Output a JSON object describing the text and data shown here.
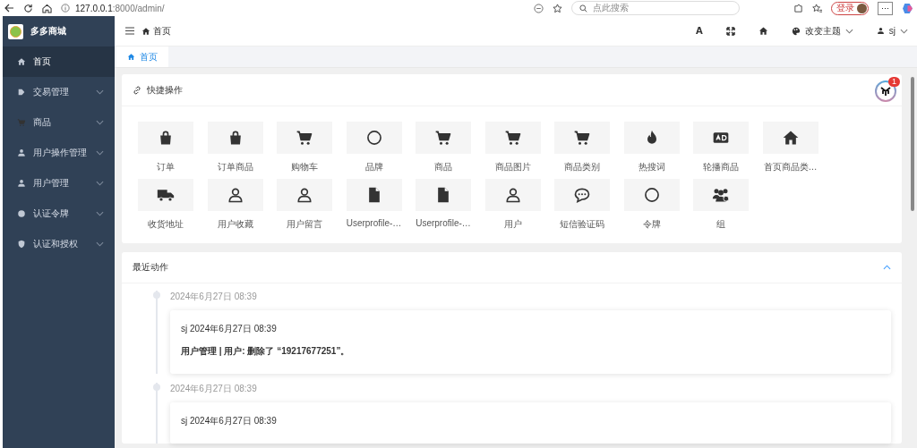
{
  "browser": {
    "url_host": "127.0.0.1",
    "url_path": ":8000/admin/",
    "search_placeholder": "点此搜索",
    "login_label": "登录",
    "more_label": "···"
  },
  "sidebar": {
    "brand": "多多商城",
    "items": [
      {
        "label": "首页",
        "kind": "home",
        "selected": true,
        "expandable": false
      },
      {
        "label": "交易管理",
        "kind": "tag",
        "selected": false,
        "expandable": true
      },
      {
        "label": "商品",
        "kind": "cart",
        "selected": false,
        "expandable": true
      },
      {
        "label": "用户操作管理",
        "kind": "person",
        "selected": false,
        "expandable": true
      },
      {
        "label": "用户管理",
        "kind": "person",
        "selected": false,
        "expandable": true
      },
      {
        "label": "认证令牌",
        "kind": "dot",
        "selected": false,
        "expandable": true
      },
      {
        "label": "认证和授权",
        "kind": "shield",
        "selected": false,
        "expandable": true
      }
    ]
  },
  "header": {
    "breadcrumb": "首页",
    "font_icon": "A",
    "theme_label": "改变主题",
    "user": "sj"
  },
  "tabs": [
    {
      "label": "首页",
      "selected": true
    }
  ],
  "shortcuts": {
    "title": "快捷操作",
    "badge": "1",
    "items": [
      {
        "label": "订单",
        "kind": "bag"
      },
      {
        "label": "订单商品",
        "kind": "bag"
      },
      {
        "label": "购物车",
        "kind": "cart"
      },
      {
        "label": "品牌",
        "kind": "circle"
      },
      {
        "label": "商品",
        "kind": "cart"
      },
      {
        "label": "商品图片",
        "kind": "cart"
      },
      {
        "label": "商品类别",
        "kind": "cart"
      },
      {
        "label": "热搜词",
        "kind": "fire"
      },
      {
        "label": "轮播商品",
        "kind": "ad"
      },
      {
        "label": "首页商品类…",
        "kind": "home"
      },
      {
        "label": "收货地址",
        "kind": "truck"
      },
      {
        "label": "用户收藏",
        "kind": "user"
      },
      {
        "label": "用户留言",
        "kind": "user"
      },
      {
        "label": "Userprofile-…",
        "kind": "file"
      },
      {
        "label": "Userprofile-…",
        "kind": "file"
      },
      {
        "label": "用户",
        "kind": "user"
      },
      {
        "label": "短信验证码",
        "kind": "chat"
      },
      {
        "label": "令牌",
        "kind": "circle"
      },
      {
        "label": "组",
        "kind": "users"
      }
    ]
  },
  "recent_actions": {
    "title": "最近动作",
    "expanded": true,
    "entries": [
      {
        "time": "2024年6月27日 08:39",
        "header": "sj 2024年6月27日 08:39",
        "message": "用户管理 | 用户: 删除了 “19217677251”。"
      },
      {
        "time": "2024年6月27日 08:39",
        "header": "sj 2024年6月27日 08:39"
      }
    ]
  }
}
